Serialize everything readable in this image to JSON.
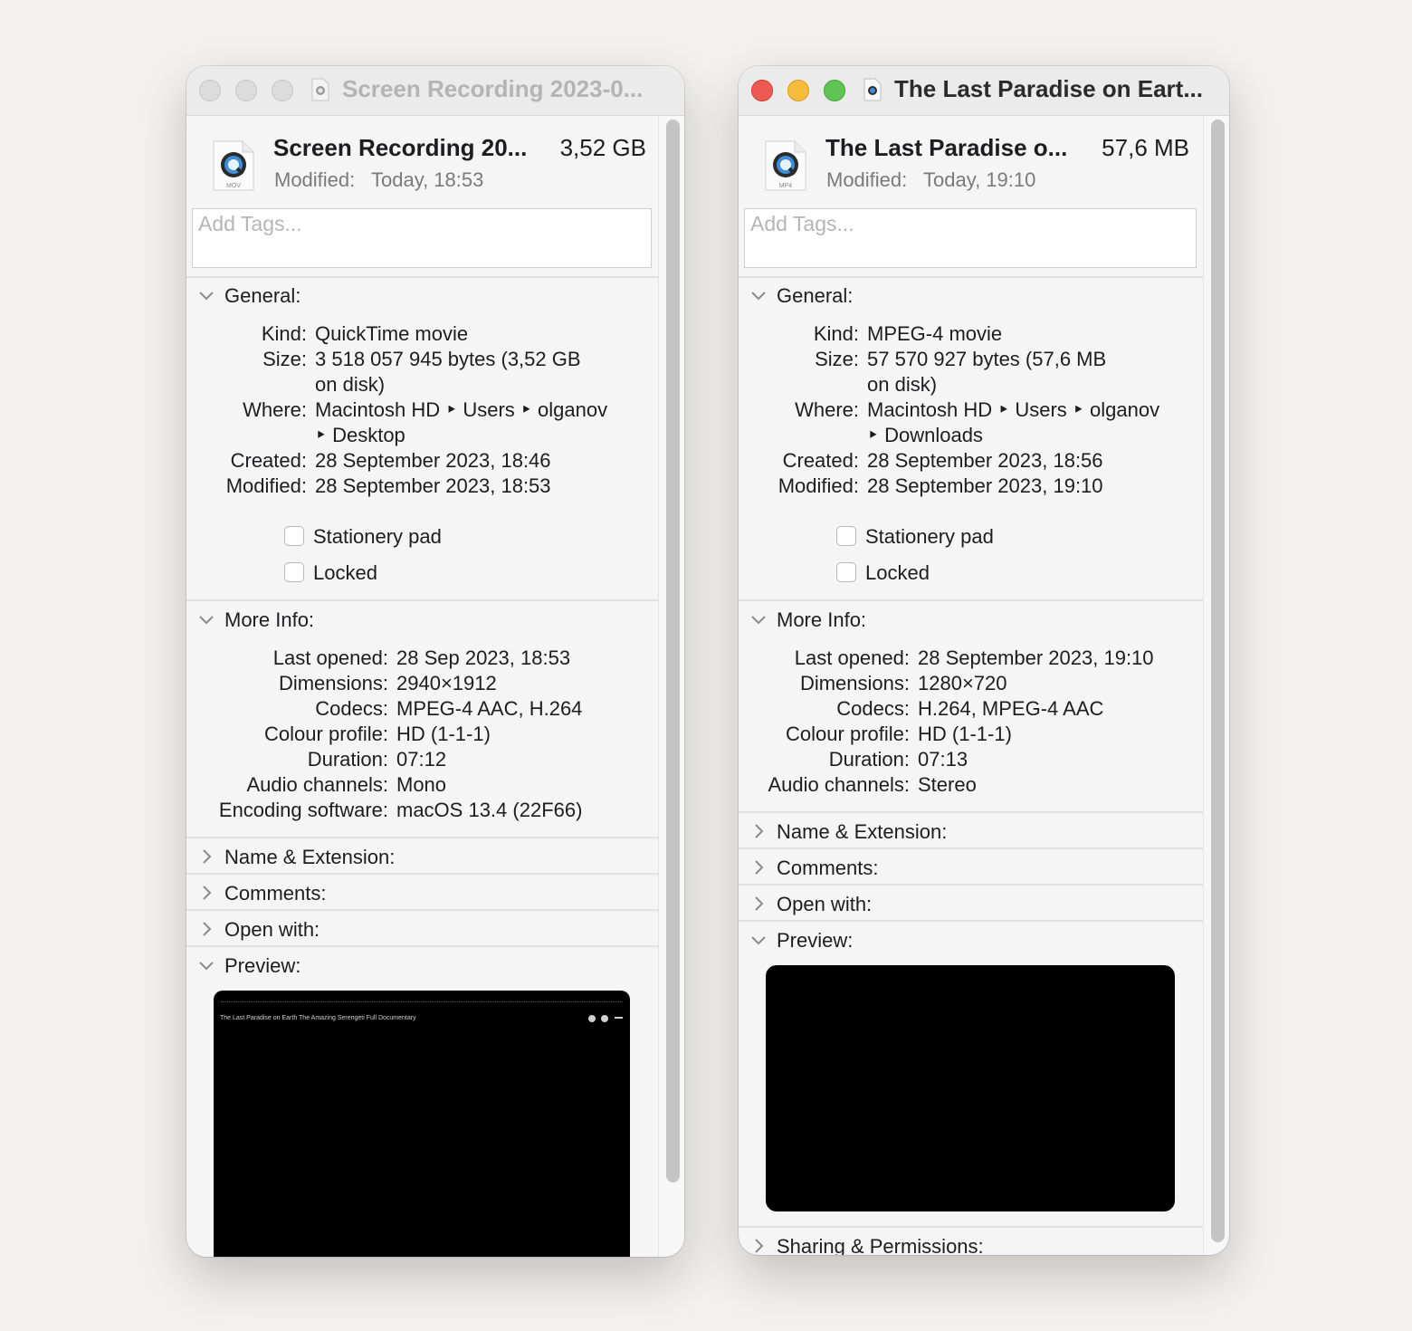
{
  "window_a": {
    "title": "Screen Recording 2023-0...",
    "file_name": "Screen Recording 20...",
    "file_size": "3,52 GB",
    "modified_label": "Modified:",
    "modified_value": "Today, 18:53",
    "file_icon_badge": "MOV",
    "tags_placeholder": "Add Tags...",
    "general": {
      "header": "General:",
      "kind_label": "Kind:",
      "kind": "QuickTime movie",
      "size_label": "Size:",
      "size_line1": "3 518 057 945 bytes (3,52 GB",
      "size_line2": "on disk)",
      "where_label": "Where:",
      "where_line1": "Macintosh HD ‣ Users ‣ olganov",
      "where_line2": "‣ Desktop",
      "created_label": "Created:",
      "created": "28 September 2023, 18:46",
      "modified_label": "Modified:",
      "modified": "28 September 2023, 18:53",
      "stationery": "Stationery pad",
      "locked": "Locked"
    },
    "more_info": {
      "header": "More Info:",
      "last_opened_label": "Last opened:",
      "last_opened": "28 Sep 2023, 18:53",
      "dimensions_label": "Dimensions:",
      "dimensions": "2940×1912",
      "codecs_label": "Codecs:",
      "codecs": "MPEG-4 AAC, H.264",
      "colour_label": "Colour profile:",
      "colour": "HD (1-1-1)",
      "duration_label": "Duration:",
      "duration": "07:12",
      "audio_label": "Audio channels:",
      "audio": "Mono",
      "encoding_label": "Encoding software:",
      "encoding": "macOS 13.4 (22F66)"
    },
    "sections": {
      "name_ext": "Name & Extension:",
      "comments": "Comments:",
      "open_with": "Open with:",
      "preview": "Preview:"
    },
    "preview_caption": "The Last Paradise on Earth  The Amazing Serengeti  Full Documentary"
  },
  "window_b": {
    "title": "The Last Paradise on Eart...",
    "file_name": "The Last Paradise o...",
    "file_size": "57,6 MB",
    "modified_label": "Modified:",
    "modified_value": "Today, 19:10",
    "file_icon_badge": "MP4",
    "tags_placeholder": "Add Tags...",
    "general": {
      "header": "General:",
      "kind_label": "Kind:",
      "kind": "MPEG-4 movie",
      "size_label": "Size:",
      "size_line1": "57 570 927 bytes (57,6 MB",
      "size_line2": "on disk)",
      "where_label": "Where:",
      "where_line1": "Macintosh HD ‣ Users ‣ olganov",
      "where_line2": "‣ Downloads",
      "created_label": "Created:",
      "created": "28 September 2023, 18:56",
      "modified_label": "Modified:",
      "modified": "28 September 2023, 19:10",
      "stationery": "Stationery pad",
      "locked": "Locked"
    },
    "more_info": {
      "header": "More Info:",
      "last_opened_label": "Last opened:",
      "last_opened": "28 September 2023, 19:10",
      "dimensions_label": "Dimensions:",
      "dimensions": "1280×720",
      "codecs_label": "Codecs:",
      "codecs": "H.264, MPEG-4 AAC",
      "colour_label": "Colour profile:",
      "colour": "HD (1-1-1)",
      "duration_label": "Duration:",
      "duration": "07:13",
      "audio_label": "Audio channels:",
      "audio": "Stereo"
    },
    "sections": {
      "name_ext": "Name & Extension:",
      "comments": "Comments:",
      "open_with": "Open with:",
      "preview": "Preview:",
      "sharing": "Sharing & Permissions:"
    }
  },
  "colors": {
    "close": "#ee5a52",
    "minimize": "#f5bd3b",
    "zoom": "#5fc454",
    "inactive_light": "#dcdcdc"
  },
  "icons": [
    "quicktime-file-icon",
    "chevron-down-icon",
    "chevron-right-icon",
    "checkbox-icon"
  ]
}
